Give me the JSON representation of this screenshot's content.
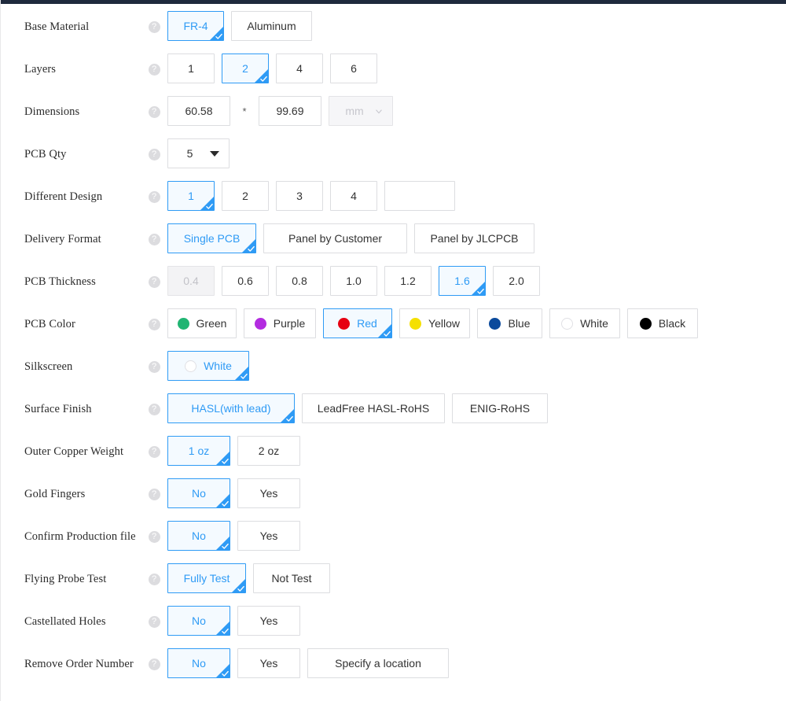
{
  "theme": {
    "accent": "#2f9bf5",
    "selected_bg": "#f4faff",
    "border": "#dcdde0",
    "topbar": "#1f2a3d",
    "label_color": "#2b2b2b",
    "disabled_text": "#c2c2c8"
  },
  "help_icon": "?",
  "multiply_symbol": "*",
  "rows": [
    {
      "id": "base-material",
      "label": "Base Material",
      "options": [
        {
          "label": "FR-4",
          "selected": true,
          "width_class": "w-fr4"
        },
        {
          "label": "Aluminum",
          "selected": false,
          "width_class": "w-alum"
        }
      ]
    },
    {
      "id": "layers",
      "label": "Layers",
      "options": [
        {
          "label": "1",
          "selected": false,
          "width_class": "w-layer"
        },
        {
          "label": "2",
          "selected": true,
          "width_class": "w-layer"
        },
        {
          "label": "4",
          "selected": false,
          "width_class": "w-layer"
        },
        {
          "label": "6",
          "selected": false,
          "width_class": "w-layer"
        }
      ]
    },
    {
      "id": "dimensions",
      "label": "Dimensions",
      "width_value": "60.58",
      "height_value": "99.69",
      "unit_value": "mm",
      "unit_disabled": true
    },
    {
      "id": "pcb-qty",
      "label": "PCB Qty",
      "qty_value": "5"
    },
    {
      "id": "different-design",
      "label": "Different Design",
      "options": [
        {
          "label": "1",
          "selected": true,
          "width_class": "w-diff"
        },
        {
          "label": "2",
          "selected": false,
          "width_class": "w-diff"
        },
        {
          "label": "3",
          "selected": false,
          "width_class": "w-diff"
        },
        {
          "label": "4",
          "selected": false,
          "width_class": "w-diff"
        }
      ],
      "custom_value": ""
    },
    {
      "id": "delivery-format",
      "label": "Delivery Format",
      "options": [
        {
          "label": "Single PCB",
          "selected": true,
          "width_class": "w-del1"
        },
        {
          "label": "Panel by Customer",
          "selected": false,
          "width_class": "w-del2"
        },
        {
          "label": "Panel by JLCPCB",
          "selected": false,
          "width_class": "w-del3"
        }
      ]
    },
    {
      "id": "pcb-thickness",
      "label": "PCB Thickness",
      "options": [
        {
          "label": "0.4",
          "selected": false,
          "disabled": true,
          "width_class": "w-thick"
        },
        {
          "label": "0.6",
          "selected": false,
          "width_class": "w-thick"
        },
        {
          "label": "0.8",
          "selected": false,
          "width_class": "w-thick"
        },
        {
          "label": "1.0",
          "selected": false,
          "width_class": "w-thick"
        },
        {
          "label": "1.2",
          "selected": false,
          "width_class": "w-thick"
        },
        {
          "label": "1.6",
          "selected": true,
          "width_class": "w-thick"
        },
        {
          "label": "2.0",
          "selected": false,
          "width_class": "w-thick"
        }
      ]
    },
    {
      "id": "pcb-color",
      "label": "PCB Color",
      "options": [
        {
          "label": "Green",
          "selected": false,
          "swatch": "#21b573",
          "width_class": "w-color"
        },
        {
          "label": "Purple",
          "selected": false,
          "swatch": "#b32ce0",
          "width_class": "w-colorp"
        },
        {
          "label": "Red",
          "selected": true,
          "swatch": "#e60012",
          "width_class": "w-color"
        },
        {
          "label": "Yellow",
          "selected": false,
          "swatch": "#f5e000",
          "width_class": "w-colory"
        },
        {
          "label": "Blue",
          "selected": false,
          "swatch": "#0b4a9c",
          "width_class": "w-colorb"
        },
        {
          "label": "White",
          "selected": false,
          "swatch": "#ffffff",
          "hollow": true,
          "width_class": "w-colorw"
        },
        {
          "label": "Black",
          "selected": false,
          "swatch": "#000000",
          "width_class": "w-colork"
        }
      ]
    },
    {
      "id": "silkscreen",
      "label": "Silkscreen",
      "options": [
        {
          "label": "White",
          "selected": true,
          "swatch": "#ffffff",
          "hollow": true,
          "width_class": "w-silk"
        }
      ]
    },
    {
      "id": "surface-finish",
      "label": "Surface Finish",
      "options": [
        {
          "label": "HASL(with lead)",
          "selected": true,
          "width_class": "w-sf1"
        },
        {
          "label": "LeadFree HASL-RoHS",
          "selected": false,
          "width_class": "w-sf2"
        },
        {
          "label": "ENIG-RoHS",
          "selected": false,
          "width_class": "w-sf3"
        }
      ]
    },
    {
      "id": "outer-copper-weight",
      "label": "Outer Copper Weight",
      "options": [
        {
          "label": "1 oz",
          "selected": true,
          "width_class": "w-oz"
        },
        {
          "label": "2 oz",
          "selected": false,
          "width_class": "w-oz"
        }
      ]
    },
    {
      "id": "gold-fingers",
      "label": "Gold Fingers",
      "options": [
        {
          "label": "No",
          "selected": true,
          "width_class": "w-yn"
        },
        {
          "label": "Yes",
          "selected": false,
          "width_class": "w-yn"
        }
      ]
    },
    {
      "id": "confirm-production-file",
      "label": "Confirm Production file",
      "options": [
        {
          "label": "No",
          "selected": true,
          "width_class": "w-yn"
        },
        {
          "label": "Yes",
          "selected": false,
          "width_class": "w-yn"
        }
      ]
    },
    {
      "id": "flying-probe-test",
      "label": "Flying Probe Test",
      "options": [
        {
          "label": "Fully Test",
          "selected": true,
          "width_class": "w-ft1"
        },
        {
          "label": "Not Test",
          "selected": false,
          "width_class": "w-ft2"
        }
      ]
    },
    {
      "id": "castellated-holes",
      "label": "Castellated Holes",
      "options": [
        {
          "label": "No",
          "selected": true,
          "width_class": "w-yn"
        },
        {
          "label": "Yes",
          "selected": false,
          "width_class": "w-yn"
        }
      ]
    },
    {
      "id": "remove-order-number",
      "label": "Remove Order Number",
      "options": [
        {
          "label": "No",
          "selected": true,
          "width_class": "w-yn"
        },
        {
          "label": "Yes",
          "selected": false,
          "width_class": "w-yn"
        },
        {
          "label": "Specify a location",
          "selected": false,
          "width_class": "w-spec"
        }
      ]
    }
  ]
}
